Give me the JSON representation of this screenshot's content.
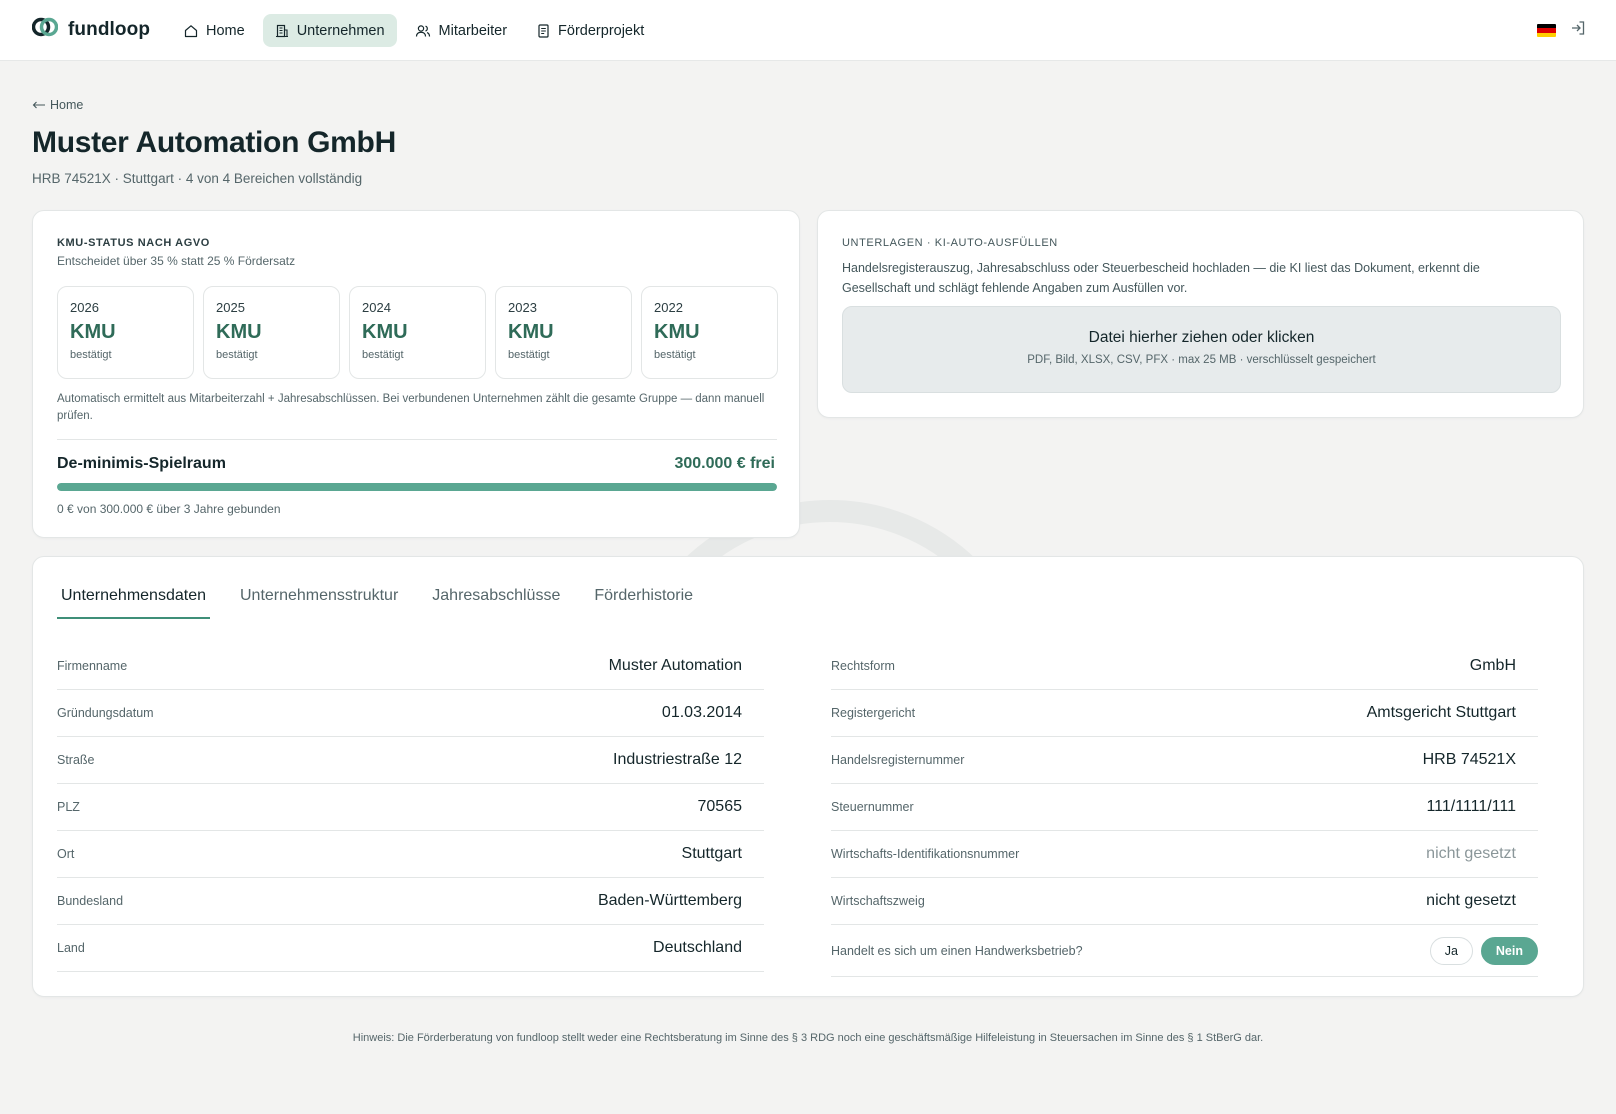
{
  "brand": {
    "name": "fundloop"
  },
  "nav": [
    {
      "label": "Home",
      "icon": "home-icon"
    },
    {
      "label": "Unternehmen",
      "icon": "building-icon",
      "active": true
    },
    {
      "label": "Mitarbeiter",
      "icon": "users-icon"
    },
    {
      "label": "Förderprojekt",
      "icon": "document-icon"
    }
  ],
  "header": {
    "back_label": "Home",
    "title": "Muster Automation GmbH",
    "subtitle": "HRB 74521X · Stuttgart · 4 von 4 Bereichen vollständig"
  },
  "kmu": {
    "overline": "KMU-STATUS NACH AGVO",
    "subtitle": "Entscheidet über 35 % statt 25 % Fördersatz",
    "years": [
      {
        "year": "2026",
        "status": "KMU",
        "confirm": "bestätigt"
      },
      {
        "year": "2025",
        "status": "KMU",
        "confirm": "bestätigt"
      },
      {
        "year": "2024",
        "status": "KMU",
        "confirm": "bestätigt"
      },
      {
        "year": "2023",
        "status": "KMU",
        "confirm": "bestätigt"
      },
      {
        "year": "2022",
        "status": "KMU",
        "confirm": "bestätigt"
      }
    ],
    "note": "Automatisch ermittelt aus Mitarbeiterzahl + Jahresabschlüssen. Bei verbundenen Unternehmen zählt die gesamte Gruppe — dann manuell prüfen.",
    "deminimis_label": "De-minimis-Spielraum",
    "deminimis_free": "300.000 € frei",
    "deminimis_free_fraction": 1.0,
    "deminimis_note": "0 € von 300.000 € über 3 Jahre gebunden"
  },
  "docs": {
    "overline": "UNTERLAGEN · KI-AUTO-AUSFÜLLEN",
    "text": "Handelsregisterauszug, Jahresabschluss oder Steuerbescheid hochladen — die KI liest das Dokument, erkennt die Gesellschaft und schlägt fehlende Angaben zum Ausfüllen vor.",
    "dropzone_title": "Datei hierher ziehen oder klicken",
    "dropzone_sub": "PDF, Bild, XLSX, CSV, PFX · max 25 MB · verschlüsselt gespeichert"
  },
  "tabs": [
    "Unternehmensdaten",
    "Unternehmensstruktur",
    "Jahresabschlüsse",
    "Förderhistorie"
  ],
  "fields_left": [
    {
      "label": "Firmenname",
      "value": "Muster Automation"
    },
    {
      "label": "Gründungsdatum",
      "value": "01.03.2014"
    },
    {
      "label": "Straße",
      "value": "Industriestraße 12"
    },
    {
      "label": "PLZ",
      "value": "70565"
    },
    {
      "label": "Ort",
      "value": "Stuttgart"
    },
    {
      "label": "Bundesland",
      "value": "Baden-Württemberg"
    },
    {
      "label": "Land",
      "value": "Deutschland"
    }
  ],
  "fields_right": [
    {
      "label": "Rechtsform",
      "value": "GmbH"
    },
    {
      "label": "Registergericht",
      "value": "Amtsgericht Stuttgart"
    },
    {
      "label": "Handelsregisternummer",
      "value": "HRB 74521X"
    },
    {
      "label": "Steuernummer",
      "value": "111/1111/111"
    },
    {
      "label": "Wirtschafts-Identifikationsnummer",
      "value": "nicht gesetzt"
    },
    {
      "label": "Wirtschaftszweig",
      "value": "nicht gesetzt"
    }
  ],
  "handwerk": {
    "question": "Handelt es sich um einen Handwerksbetrieb?",
    "yes": "Ja",
    "no": "Nein",
    "selected": "no"
  },
  "footer": "Hinweis: Die Förderberatung von fundloop stellt weder eine Rechtsberatung im Sinne des § 3 RDG noch eine geschäftsmäßige Hilfeleistung in Steuersachen im Sinne des § 1 StBerG dar.",
  "colors": {
    "accent": "#5aa792",
    "accent_dark": "#2f6b58",
    "active_nav_bg": "#dcebe4"
  }
}
